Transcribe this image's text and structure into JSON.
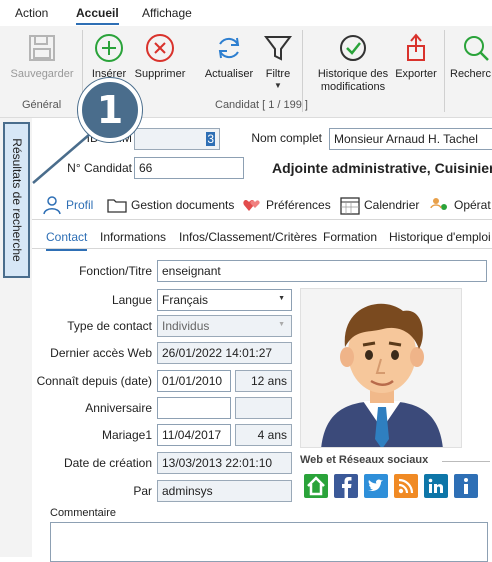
{
  "menu": {
    "action": "Action",
    "accueil": "Accueil",
    "affichage": "Affichage"
  },
  "ribbon": {
    "save": "Sauvegarder",
    "insert": "Insérer",
    "delete": "Supprimer",
    "refresh": "Actualiser",
    "filter": "Filtre",
    "history_line1": "Historique des",
    "history_line2": "modifications",
    "export": "Exporter",
    "search": "Recherc",
    "group_general": "Général",
    "group_candidat": "Candidat [ 1 / 199 ]"
  },
  "side_tab": {
    "label": "Résultats de recherche"
  },
  "badge": {
    "number": "1"
  },
  "header": {
    "id_label": "ID PRIM",
    "id_value": "3",
    "nom_label": "Nom complet",
    "nom_value": "Monsieur Arnaud H. Tachel",
    "num_label": "N° Candidat",
    "num_value": "66",
    "title": "Adjointe administrative, Cuisinier,"
  },
  "tabs": [
    "Profil",
    "Gestion documents",
    "Préférences",
    "Calendrier",
    "Opérat"
  ],
  "subtabs": [
    "Contact",
    "Informations",
    "Infos/Classement/Critères",
    "Formation",
    "Historique d'emploi"
  ],
  "form": {
    "fonction_label": "Fonction/Titre",
    "fonction_value": "enseignant",
    "langue_label": "Langue",
    "langue_value": "Français",
    "type_label": "Type de contact",
    "type_value": "Individus",
    "acces_label": "Dernier accès Web",
    "acces_value": "26/01/2022 14:01:27",
    "connait_label": "Connaît depuis (date)",
    "connait_value": "01/01/2010",
    "connait_years": "12 ans",
    "anniv_label": "Anniversaire",
    "anniv_value": "",
    "anniv_years": "",
    "mariage_label": "Mariage1",
    "mariage_value": "11/04/2017",
    "mariage_years": "4 ans",
    "creation_label": "Date de création",
    "creation_value": "13/03/2013 22:01:10",
    "par_label": "Par",
    "par_value": "adminsys",
    "commentaire_label": "Commentaire",
    "commentaire_value": ""
  },
  "web": {
    "title": "Web et Réseaux sociaux"
  },
  "colors": {
    "accent": "#2e6fb5",
    "badge": "#4a6d8c",
    "sidebar_bg": "#d7e7f6"
  }
}
